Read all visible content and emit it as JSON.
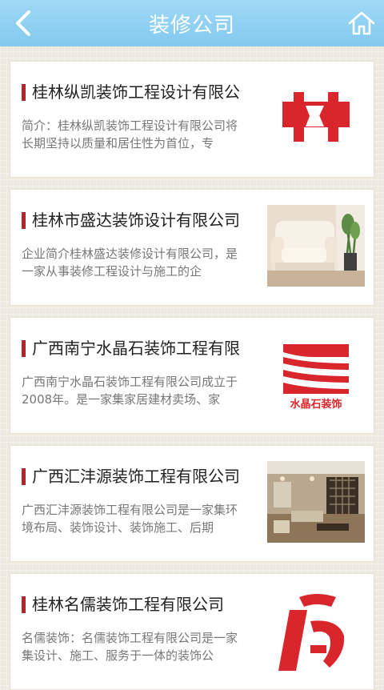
{
  "header": {
    "title": "装修公司",
    "back_icon": "chevron-left-icon",
    "home_icon": "home-icon"
  },
  "companies": [
    {
      "name": "桂林纵凯装饰工程设计有限公",
      "description": "简介：桂林纵凯装饰工程设计有限公司将长期坚持以质量和居住性为首位，专",
      "image": "zongkai-logo"
    },
    {
      "name": "桂林市盛达装饰设计有限公司",
      "description": "企业简介桂林盛达装修设计有限公司，是一家从事装修工程设计与施工的企",
      "image": "sofa-photo"
    },
    {
      "name": "广西南宁水晶石装饰工程有限",
      "description": "广西南宁水晶石装饰工程有限公司成立于2008年。是一家集家居建材卖场、家",
      "image": "shuijingshi-logo",
      "logo_text": "水晶石装饰"
    },
    {
      "name": "广西汇沣源装饰工程有限公司",
      "description": "广西汇沣源装饰工程有限公司是一家集环境布局、装饰设计、装饰施工、后期",
      "image": "living-room-photo"
    },
    {
      "name": "桂林名儒装饰工程有限公司",
      "description": "名儒装饰：名儒装饰工程有限公司是一家集设计、施工、服务于一体的装饰公",
      "image": "mingru-logo"
    }
  ],
  "colors": {
    "header_bg": "#8dd0f2",
    "accent_bar": "#b3262a",
    "logo_red": "#d9262c"
  }
}
